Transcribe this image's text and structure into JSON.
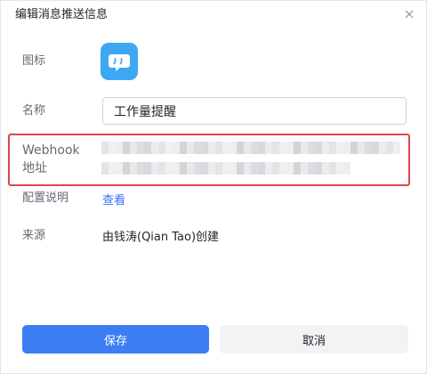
{
  "dialog": {
    "title": "编辑消息推送信息",
    "close_icon": "close-icon"
  },
  "form": {
    "icon_label": "图标",
    "app_icon": "chat-bubble-icon",
    "app_icon_color": "#3ea7f4",
    "name_label": "名称",
    "name_value": "工作量提醒",
    "webhook_label_line1": "Webhook",
    "webhook_label_line2": "地址",
    "webhook_value_obscured": true,
    "highlight_color": "#e04848",
    "config_label": "配置说明",
    "config_link": "查看",
    "source_label": "来源",
    "source_value": "由钱涛(Qian Tao)创建"
  },
  "footer": {
    "save_label": "保存",
    "cancel_label": "取消",
    "primary_color": "#3c7df3"
  }
}
